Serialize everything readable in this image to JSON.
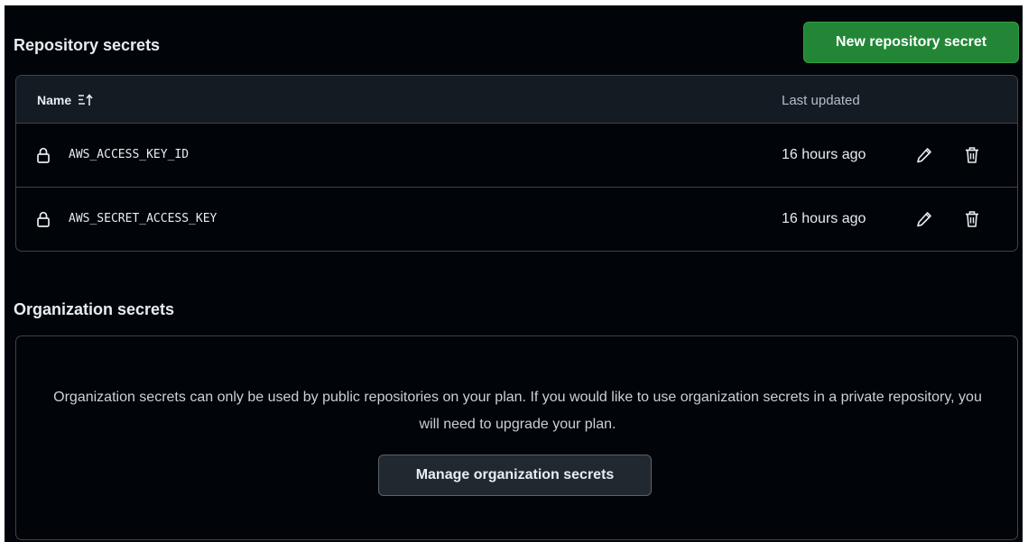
{
  "colors": {
    "background": "#010409",
    "header_bg": "#151b23",
    "border": "#3d444d",
    "primary_button": "#238636",
    "secondary_button": "#212830",
    "text": "#e6edf3"
  },
  "repository_secrets": {
    "title": "Repository secrets",
    "new_button_label": "New repository secret",
    "table": {
      "columns": {
        "name": "Name",
        "last_updated": "Last updated"
      },
      "sort_icon": "sort-ascending-icon",
      "rows": [
        {
          "name": "AWS_ACCESS_KEY_ID",
          "last_updated": "16 hours ago"
        },
        {
          "name": "AWS_SECRET_ACCESS_KEY",
          "last_updated": "16 hours ago"
        }
      ]
    },
    "row_icons": {
      "lock": "lock-icon",
      "edit": "pencil-icon",
      "delete": "trash-icon"
    }
  },
  "organization_secrets": {
    "title": "Organization secrets",
    "message": "Organization secrets can only be used by public repositories on your plan. If you would like to use organization secrets in a private repository, you will need to upgrade your plan.",
    "manage_button_label": "Manage organization secrets"
  }
}
